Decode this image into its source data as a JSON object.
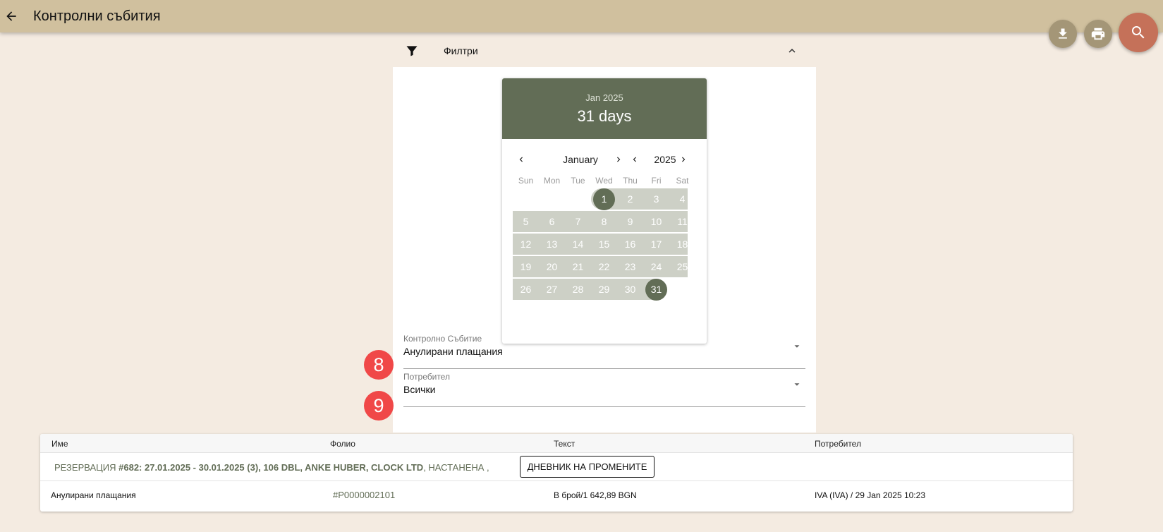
{
  "header": {
    "title": "Контролни събития"
  },
  "filters": {
    "label": "Филтри"
  },
  "calendar": {
    "header_month": "Jan 2025",
    "header_days": "31 days",
    "nav_month": "January",
    "nav_year": "2025",
    "weekdays": [
      "Sun",
      "Mon",
      "Tue",
      "Wed",
      "Thu",
      "Fri",
      "Sat"
    ],
    "days": [
      "1",
      "2",
      "3",
      "4",
      "5",
      "6",
      "7",
      "8",
      "9",
      "10",
      "11",
      "12",
      "13",
      "14",
      "15",
      "16",
      "17",
      "18",
      "19",
      "20",
      "21",
      "22",
      "23",
      "24",
      "25",
      "26",
      "27",
      "28",
      "29",
      "30",
      "31"
    ],
    "range_start": "1",
    "range_end": "31"
  },
  "fields": {
    "event": {
      "label": "Контролно Събитие",
      "value": "Анулирани плащания"
    },
    "user": {
      "label": "Потребител",
      "value": "Всички"
    }
  },
  "badges": {
    "event": "8",
    "user": "9"
  },
  "table": {
    "columns": [
      "Име",
      "Фолио",
      "Текст",
      "Потребител"
    ],
    "reservation": {
      "prefix": "РЕЗЕРВАЦИЯ ",
      "bold": "#682: 27.01.2025 - 30.01.2025 (3), 106 DBL, ANKE HUBER, CLOCK LTD",
      "suffix": ", НАСТАНЕНА ,",
      "button_label": "ДНЕВНИК НА ПРОМЕНИТЕ"
    },
    "rows": [
      {
        "name": "Анулирани плащания",
        "folio": "#P0000002101",
        "text": "В брой/1 642,89 BGN",
        "user": "IVA (IVA) / 29 Jan 2025 10:23"
      }
    ]
  },
  "colors": {
    "topbar": "#d0c09e",
    "accent": "#626d56",
    "range_band": "#cdd0c6",
    "fab_secondary": "#a49677",
    "fab_primary": "#c57159",
    "badge": "#f04848"
  }
}
